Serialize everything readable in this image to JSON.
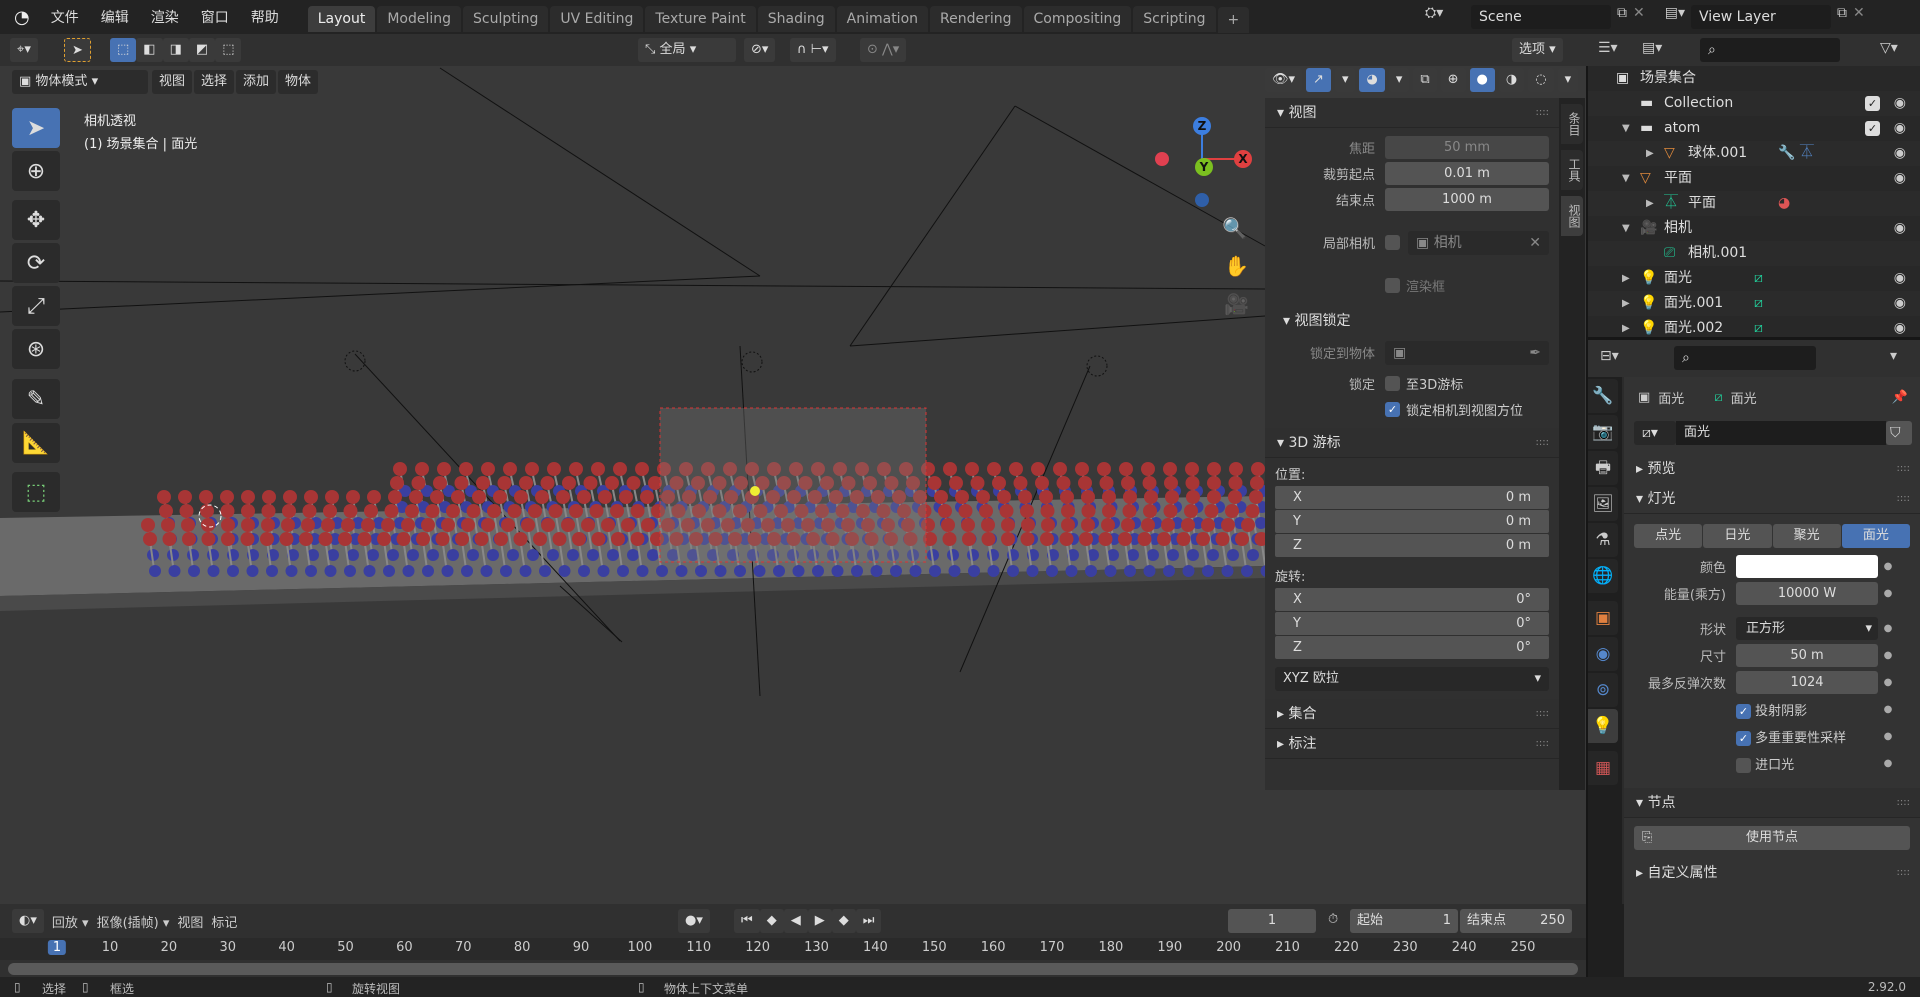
{
  "topbar": {
    "menus": [
      "文件",
      "编辑",
      "渲染",
      "窗口",
      "帮助"
    ],
    "tabs": [
      "Layout",
      "Modeling",
      "Sculpting",
      "UV Editing",
      "Texture Paint",
      "Shading",
      "Animation",
      "Rendering",
      "Compositing",
      "Scripting"
    ],
    "active_tab": "Layout",
    "add_tab": "+",
    "scene": "Scene",
    "view_layer": "View Layer"
  },
  "viewport_header": {
    "transform_orientation": "全局",
    "options": "选项",
    "mode": "物体模式",
    "menus": [
      "视图",
      "选择",
      "添加",
      "物体"
    ]
  },
  "viewport": {
    "title": "相机透视",
    "subtitle": "(1) 场景集合 | 面光",
    "gizmo": {
      "z": "Z",
      "x": "X",
      "y": "Y"
    }
  },
  "npanel": {
    "tabs": [
      "条目",
      "工具",
      "视图"
    ],
    "active_tab": "视图",
    "view": {
      "header": "视图",
      "focal_label": "焦距",
      "focal": "50 mm",
      "clip_start_label": "裁剪起点",
      "clip_start": "0.01 m",
      "clip_end_label": "结束点",
      "clip_end": "1000 m",
      "local_camera_label": "局部相机",
      "local_camera": "相机",
      "render_region": "渲染框"
    },
    "view_lock": {
      "header": "视图锁定",
      "lock_object_label": "锁定到物体",
      "lock_label": "锁定",
      "to_cursor": "至3D游标",
      "to_cursor_checked": false,
      "camera_to_view": "锁定相机到视图方位",
      "camera_to_view_checked": true
    },
    "cursor": {
      "header": "3D 游标",
      "location_label": "位置:",
      "location": [
        {
          "axis": "X",
          "value": "0 m"
        },
        {
          "axis": "Y",
          "value": "0 m"
        },
        {
          "axis": "Z",
          "value": "0 m"
        }
      ],
      "rotation_label": "旋转:",
      "rotation": [
        {
          "axis": "X",
          "value": "0°"
        },
        {
          "axis": "Y",
          "value": "0°"
        },
        {
          "axis": "Z",
          "value": "0°"
        }
      ],
      "rotation_mode": "XYZ 欧拉"
    },
    "collections": "集合",
    "annotations": "标注"
  },
  "outliner": {
    "rows": [
      {
        "name": "场景集合",
        "indent": 0,
        "arrow": "",
        "icon": "scene-collection-icon"
      },
      {
        "name": "Collection",
        "indent": 1,
        "arrow": "",
        "icon": "collection-icon",
        "check": true,
        "eye": true
      },
      {
        "name": "atom",
        "indent": 1,
        "arrow": "▼",
        "icon": "collection-icon",
        "check": true,
        "eye": true
      },
      {
        "name": "球体.001",
        "indent": 2,
        "arrow": "▶",
        "icon": "mesh-object-icon",
        "extra": "modifier-mesh",
        "eye": true
      },
      {
        "name": "平面",
        "indent": 1,
        "arrow": "▼",
        "icon": "mesh-object-icon",
        "eye": true
      },
      {
        "name": "平面",
        "indent": 2,
        "arrow": "▶",
        "icon": "mesh-data-icon",
        "extra": "material"
      },
      {
        "name": "相机",
        "indent": 1,
        "arrow": "▼",
        "icon": "camera-object-icon",
        "eye": true
      },
      {
        "name": "相机.001",
        "indent": 2,
        "arrow": "",
        "icon": "camera-data-icon"
      },
      {
        "name": "面光",
        "indent": 1,
        "arrow": "▶",
        "icon": "light-object-icon",
        "extra": "light",
        "eye": true
      },
      {
        "name": "面光.001",
        "indent": 1,
        "arrow": "▶",
        "icon": "light-object-icon",
        "extra": "light",
        "eye": true
      },
      {
        "name": "面光.002",
        "indent": 1,
        "arrow": "▶",
        "icon": "light-object-icon",
        "extra": "light",
        "eye": true
      }
    ]
  },
  "properties": {
    "breadcrumb_object": "面光",
    "breadcrumb_data": "面光",
    "datablock": "面光",
    "preview": "预览",
    "light": "灯光",
    "light_types": [
      "点光",
      "日光",
      "聚光",
      "面光"
    ],
    "active_type": "面光",
    "color_label": "颜色",
    "color": "#ffffff",
    "power_label": "能量(乘方)",
    "power": "10000 W",
    "shape_label": "形状",
    "shape": "正方形",
    "size_label": "尺寸",
    "size": "50 m",
    "bounces_label": "最多反弹次数",
    "bounces": "1024",
    "cast_shadow": "投射阴影",
    "cast_shadow_checked": true,
    "mis": "多重重要性采样",
    "mis_checked": true,
    "portal": "进口光",
    "portal_checked": false,
    "nodes": "节点",
    "use_nodes": "使用节点",
    "custom_props": "自定义属性"
  },
  "timeline": {
    "playback": "回放",
    "keying": "抠像(插帧)",
    "view": "视图",
    "marker": "标记",
    "current_frame": "1",
    "start_label": "起始",
    "start": "1",
    "end_label": "结束点",
    "end": "250",
    "ruler": [
      "1",
      "10",
      "20",
      "30",
      "40",
      "50",
      "60",
      "70",
      "80",
      "90",
      "100",
      "110",
      "120",
      "130",
      "140",
      "150",
      "160",
      "170",
      "180",
      "190",
      "200",
      "210",
      "220",
      "230",
      "240",
      "250"
    ]
  },
  "status": {
    "select": "选择",
    "box_select": "框选",
    "rotate_view": "旋转视图",
    "context_menu": "物体上下文菜单",
    "version": "2.92.0"
  },
  "colors": {
    "accent": "#4772b3",
    "atom_red": "#b23a3a",
    "atom_blue": "#3a3fa0"
  }
}
